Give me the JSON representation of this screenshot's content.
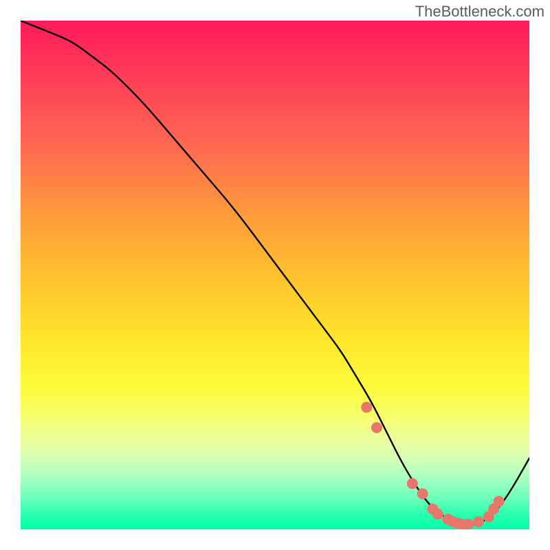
{
  "watermark": "TheBottleneck.com",
  "chart_data": {
    "type": "line",
    "title": "",
    "xlabel": "",
    "ylabel": "",
    "xlim": [
      0,
      100
    ],
    "ylim": [
      0,
      100
    ],
    "grid": false,
    "legend": false,
    "series": [
      {
        "name": "bottleneck-curve",
        "x": [
          0,
          5,
          10,
          14,
          18,
          24,
          30,
          36,
          42,
          48,
          54,
          60,
          63,
          66,
          69,
          72,
          75,
          78,
          81,
          84,
          87,
          90,
          93,
          96,
          100
        ],
        "y": [
          100,
          98,
          96,
          93,
          90,
          84,
          77,
          70,
          63,
          55,
          47,
          39,
          35,
          30,
          25,
          19,
          13,
          8,
          4,
          2,
          1,
          1,
          3,
          7,
          14
        ]
      }
    ],
    "markers": [
      {
        "x": 68,
        "y": 24
      },
      {
        "x": 70,
        "y": 20
      },
      {
        "x": 77,
        "y": 9
      },
      {
        "x": 79,
        "y": 7
      },
      {
        "x": 81,
        "y": 4
      },
      {
        "x": 82,
        "y": 3
      },
      {
        "x": 84,
        "y": 2
      },
      {
        "x": 85,
        "y": 1.5
      },
      {
        "x": 86,
        "y": 1.2
      },
      {
        "x": 87,
        "y": 1
      },
      {
        "x": 88,
        "y": 1
      },
      {
        "x": 90,
        "y": 1.5
      },
      {
        "x": 92,
        "y": 2.5
      },
      {
        "x": 93,
        "y": 4
      },
      {
        "x": 94,
        "y": 5.5
      }
    ],
    "gradient_stops": [
      {
        "offset": 0,
        "color": "#ff1a5a"
      },
      {
        "offset": 25,
        "color": "#ff6a50"
      },
      {
        "offset": 50,
        "color": "#fec12e"
      },
      {
        "offset": 72,
        "color": "#fdfb3a"
      },
      {
        "offset": 88,
        "color": "#d6ffb6"
      },
      {
        "offset": 100,
        "color": "#00ffaa"
      }
    ]
  }
}
